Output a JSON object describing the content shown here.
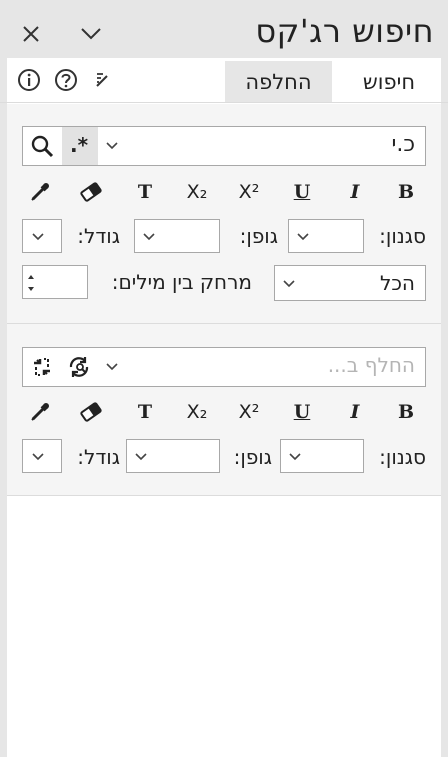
{
  "header": {
    "title": "חיפוש רג'קס"
  },
  "tabs": [
    {
      "label": "חיפוש",
      "active": false
    },
    {
      "label": "החלפה",
      "active": true
    }
  ],
  "search": {
    "value": "כ.י",
    "regex_symbol": ".*"
  },
  "replace": {
    "placeholder": "החלף ב..."
  },
  "format_buttons": [
    "B",
    "I",
    "U",
    "X²",
    "X₂",
    "T"
  ],
  "find_format": {
    "style_label": "סגנון:",
    "font_label": "גופן:",
    "size_label": "גודל:"
  },
  "word_spacing": {
    "label": "מרחק בין מילים:",
    "scope_value": "הכל"
  },
  "replace_format": {
    "style_label": "סגנון:",
    "font_label": "גופן:",
    "size_label": "גודל:"
  },
  "icons": [
    "close-icon",
    "chevron-down-icon",
    "info-icon",
    "help-icon",
    "edit-icon",
    "search-icon",
    "regex-icon",
    "replace-icon",
    "replace-all-icon",
    "eraser-icon",
    "eyedropper-icon"
  ]
}
